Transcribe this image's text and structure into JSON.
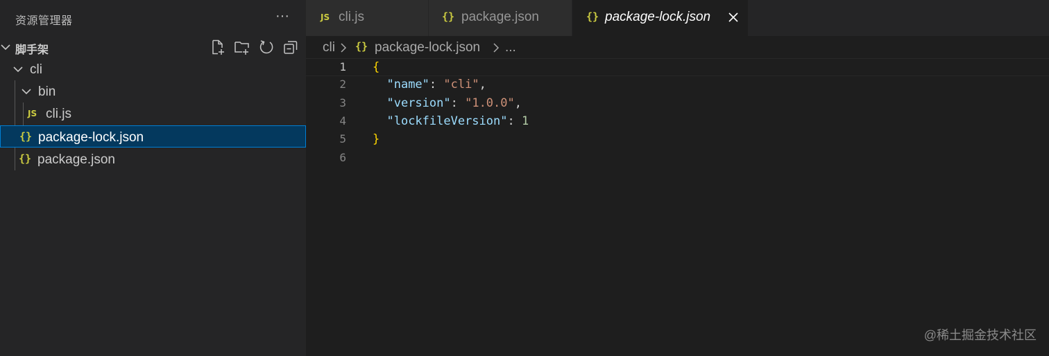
{
  "sidebar": {
    "title": "资源管理器",
    "more_label": "···",
    "section_title": "脚手架",
    "tree": {
      "cli": "cli",
      "bin": "bin",
      "cli_js": "cli.js",
      "package_lock": "package-lock.json",
      "package": "package.json"
    }
  },
  "tabs": [
    {
      "label": "cli.js",
      "icon": "JS"
    },
    {
      "label": "package.json",
      "icon": "{}"
    },
    {
      "label": "package-lock.json",
      "icon": "{}"
    }
  ],
  "breadcrumb": {
    "folder": "cli",
    "file": "package-lock.json",
    "more": "..."
  },
  "editor": {
    "line_numbers": [
      "1",
      "2",
      "3",
      "4",
      "5",
      "6"
    ],
    "lines": [
      {
        "tokens": [
          {
            "t": "brace",
            "v": "{"
          }
        ]
      },
      {
        "tokens": [
          {
            "t": "punc",
            "v": "  "
          },
          {
            "t": "key",
            "v": "\"name\""
          },
          {
            "t": "punc",
            "v": ": "
          },
          {
            "t": "str",
            "v": "\"cli\""
          },
          {
            "t": "punc",
            "v": ","
          }
        ]
      },
      {
        "tokens": [
          {
            "t": "punc",
            "v": "  "
          },
          {
            "t": "key",
            "v": "\"version\""
          },
          {
            "t": "punc",
            "v": ": "
          },
          {
            "t": "str",
            "v": "\"1.0.0\""
          },
          {
            "t": "punc",
            "v": ","
          }
        ]
      },
      {
        "tokens": [
          {
            "t": "punc",
            "v": "  "
          },
          {
            "t": "key",
            "v": "\"lockfileVersion\""
          },
          {
            "t": "punc",
            "v": ": "
          },
          {
            "t": "num",
            "v": "1"
          }
        ]
      },
      {
        "tokens": [
          {
            "t": "brace",
            "v": "}"
          }
        ]
      },
      {
        "tokens": []
      }
    ]
  },
  "watermark": "@稀土掘金技术社区",
  "colors": {
    "accent": "#007fd4",
    "selection": "#04395e",
    "json_icon": "#cbcb41"
  }
}
